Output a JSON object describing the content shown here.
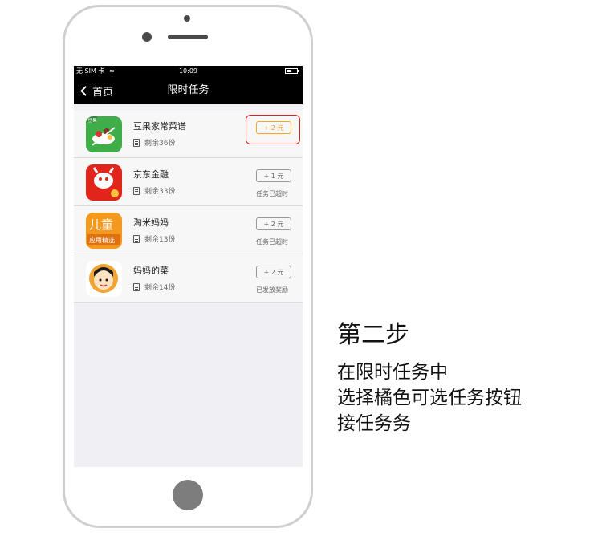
{
  "statusbar": {
    "carrier": "无 SIM 卡",
    "time": "10:09"
  },
  "navbar": {
    "back_label": "首页",
    "title": "限时任务"
  },
  "tasks": [
    {
      "name": "豆果家常菜谱",
      "remaining": "剩余36份",
      "reward": "+ 2 元",
      "status": "",
      "highlighted": true,
      "icon_badge": "豆果",
      "accent": "#f5a623"
    },
    {
      "name": "京东金融",
      "remaining": "剩余33份",
      "reward": "+ 1 元",
      "status": "任务已超时",
      "highlighted": false,
      "icon_badge": ""
    },
    {
      "name": "淘米妈妈",
      "remaining": "剩余13份",
      "reward": "+ 2 元",
      "status": "任务已超时",
      "highlighted": false,
      "icon_badge": "儿童",
      "icon_subtext": "应用精选"
    },
    {
      "name": "妈妈的菜",
      "remaining": "剩余14份",
      "reward": "+ 2 元",
      "status": "已发放奖励",
      "highlighted": false,
      "icon_badge": ""
    }
  ],
  "caption": {
    "title": "第二步",
    "lines": [
      "在限时任务中",
      "选择橘色可选任务按钮",
      "接任务务"
    ]
  },
  "colors": {
    "highlight_border": "#e02020",
    "active_button": "#f5a623",
    "navbar": "#000000"
  }
}
